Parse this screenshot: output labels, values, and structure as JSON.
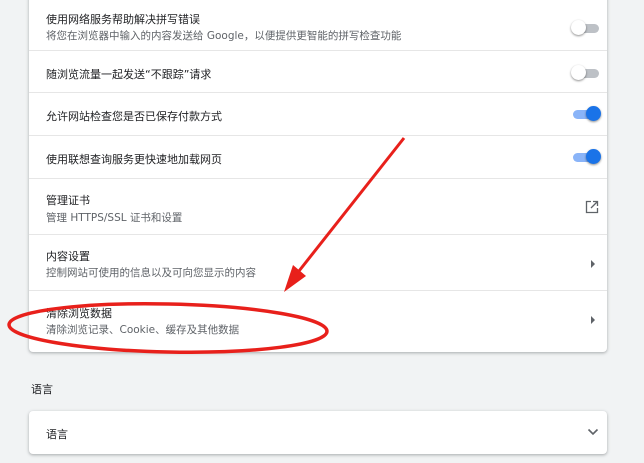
{
  "settings": {
    "items": [
      {
        "title": "使用网络服务帮助解决拼写错误",
        "subtitle": "将您在浏览器中输入的内容发送给 Google，以便提供更智能的拼写检查功能",
        "control": "toggle",
        "enabled": false
      },
      {
        "title": "随浏览流量一起发送“不跟踪”请求",
        "control": "toggle",
        "enabled": false
      },
      {
        "title": "允许网站检查您是否已保存付款方式",
        "control": "toggle",
        "enabled": true
      },
      {
        "title": "使用联想查询服务更快速地加载网页",
        "control": "toggle",
        "enabled": true
      },
      {
        "title": "管理证书",
        "subtitle": "管理 HTTPS/SSL 证书和设置",
        "control": "external-link-icon"
      },
      {
        "title": "内容设置",
        "subtitle": "控制网站可使用的信息以及可向您显示的内容",
        "control": "chevron-right-icon"
      },
      {
        "title": "清除浏览数据",
        "subtitle": "清除浏览记录、Cookie、缓存及其他数据",
        "control": "chevron-right-icon"
      }
    ]
  },
  "language": {
    "heading": "语言",
    "row_label": "语言",
    "control": "chevron-down-icon"
  },
  "colors": {
    "toggle_on": "#1a73e8",
    "toggle_on_track": "#8ab4f8",
    "toggle_off_track": "#bdc1c6",
    "annotation": "#e8201b",
    "page_background": "#f1f3f4"
  }
}
